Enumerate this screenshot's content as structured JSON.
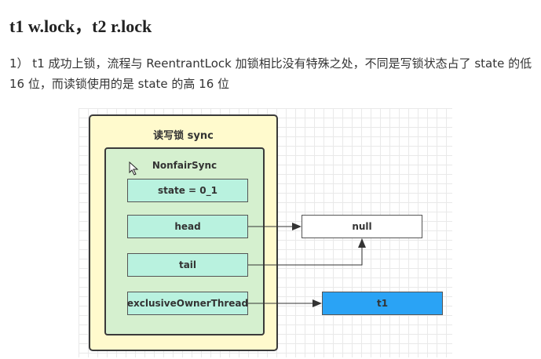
{
  "heading": "t1 w.lock，t2 r.lock",
  "paragraph": "1） t1 成功上锁，流程与 ReentrantLock 加锁相比没有特殊之处，不同是写锁状态占了 state 的低 16 位，而读锁使用的是 state 的高 16 位",
  "diagram": {
    "outer_label": "读写锁 sync",
    "inner_label": "NonfairSync",
    "fields": {
      "state": "state = 0_1",
      "head": "head",
      "tail": "tail",
      "owner": "exclusiveOwnerThread"
    },
    "null_label": "null",
    "t1_label": "t1"
  },
  "colors": {
    "outer_fill": "#fffacd",
    "inner_fill": "#d5f0cf",
    "field_fill": "#b9f2df",
    "t1_fill": "#2aa3f5"
  }
}
